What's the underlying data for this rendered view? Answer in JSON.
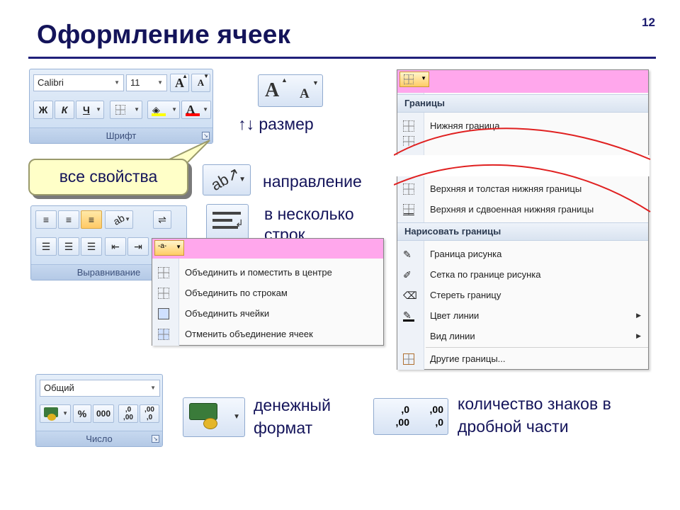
{
  "slide": {
    "number": "12",
    "title": "Оформление ячеек"
  },
  "font_group": {
    "font_name": "Calibri",
    "font_size": "11",
    "grow_glyph": "A",
    "shrink_glyph": "A",
    "bold": "Ж",
    "italic": "К",
    "underline": "Ч",
    "caption": "Шрифт",
    "highlight_color": "#ffff00",
    "font_color": "#ff0000"
  },
  "callout": {
    "text": "все свойства"
  },
  "size_item": {
    "label": "↑↓ размер",
    "big_glyph": "A",
    "small_glyph": "A"
  },
  "direction_item": {
    "label": "направление"
  },
  "wrap_item": {
    "label": "в несколько строк"
  },
  "align_group": {
    "caption": "Выравнивание",
    "merge_glyph": "-a-"
  },
  "merge_menu": {
    "items": [
      "Объединить и поместить в центре",
      "Объединить по строкам",
      "Объединить ячейки",
      "Отменить объединение ячеек"
    ]
  },
  "borders_menu": {
    "section_borders": "Границы",
    "item_bottom": "Нижняя граница",
    "item_thick_bottom": "Верхняя и толстая нижняя границы",
    "item_double_bottom": "Верхняя и сдвоенная нижняя границы",
    "section_draw": "Нарисовать границы",
    "draw_items": [
      "Граница рисунка",
      "Сетка по границе рисунка",
      "Стереть границу",
      "Цвет линии",
      "Вид линии"
    ],
    "other": "Другие границы...",
    "cut_line_color": "#e02020"
  },
  "number_group": {
    "format": "Общий",
    "percent": "%",
    "thousands": "000",
    "inc_top": ",0",
    "inc_bottom": ",00",
    "dec_top": ",00",
    "dec_bottom": ",0",
    "caption": "Число"
  },
  "currency_item": {
    "label": "денежный формат"
  },
  "decimals_item": {
    "label": "количество знаков в дробной части",
    "inc_top": ",0",
    "inc_bottom": ",00",
    "dec_top": ",00",
    "dec_bottom": ",0"
  },
  "colors": {
    "title": "#14145a",
    "menu_bar": "#ffa7ec",
    "ribbon": "#d5e3f5"
  }
}
